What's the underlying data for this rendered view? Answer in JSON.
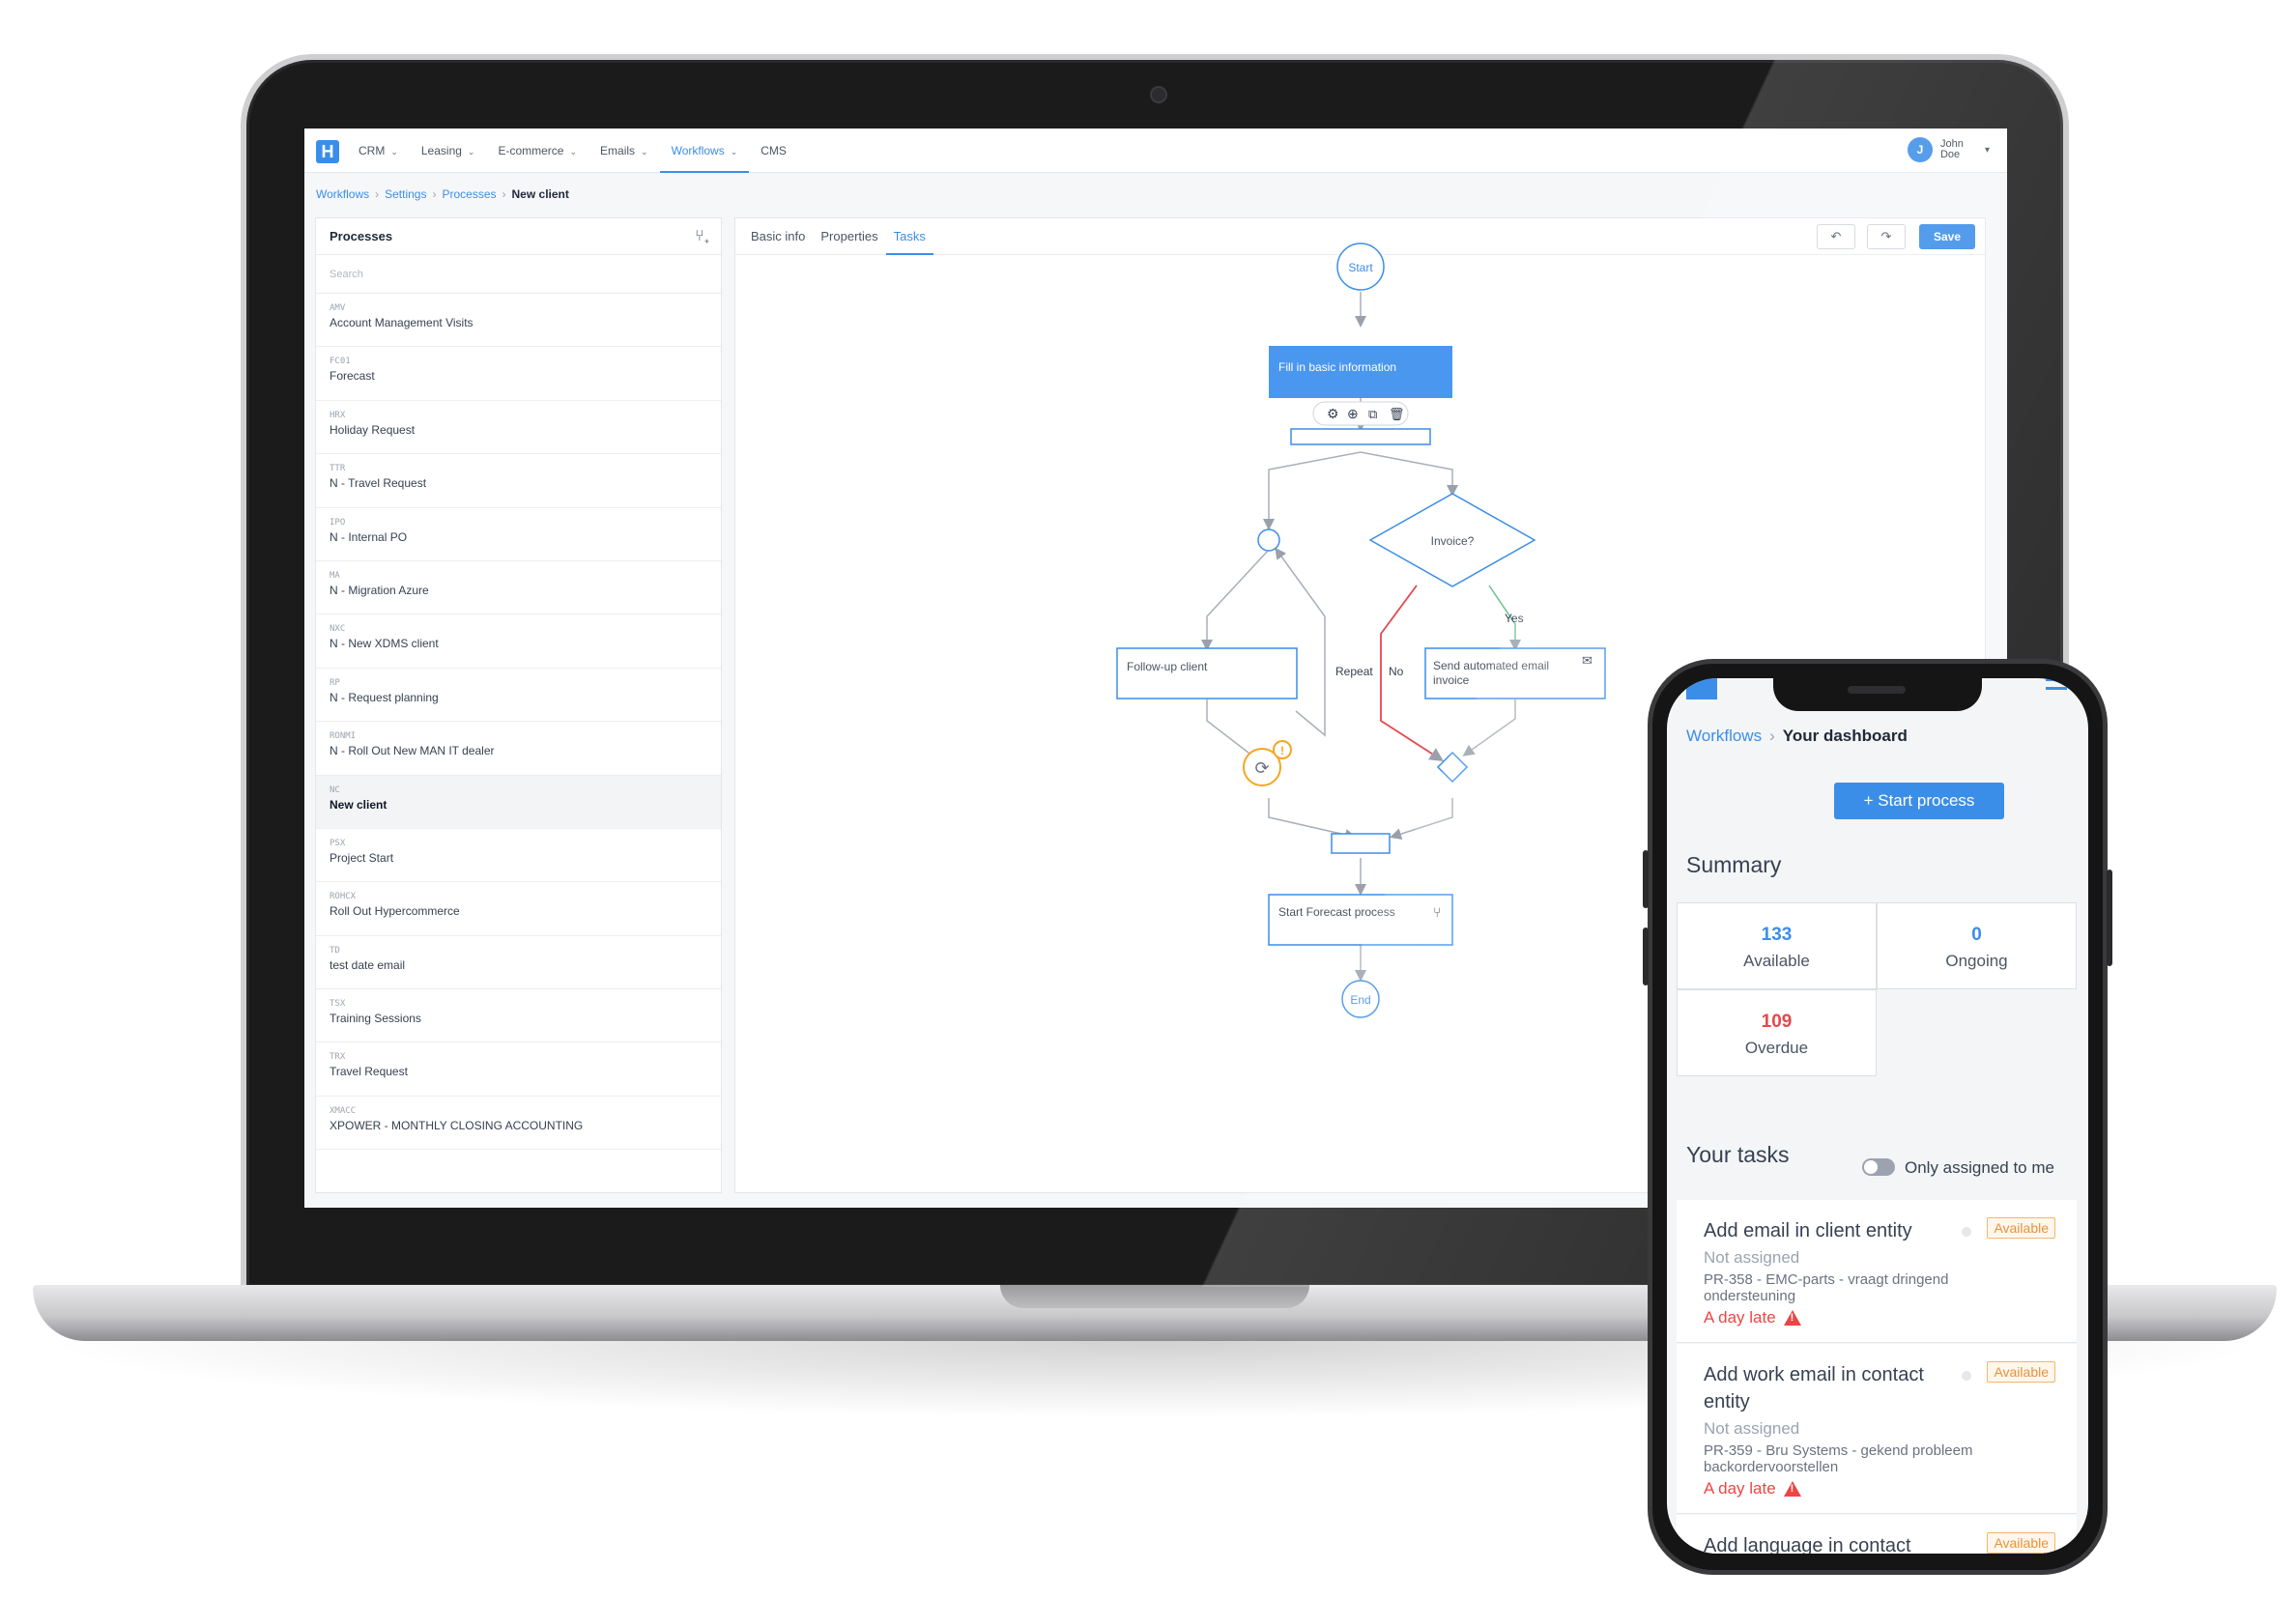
{
  "laptop": {
    "nav": {
      "logo": "H",
      "items": [
        {
          "label": "CRM",
          "active": false
        },
        {
          "label": "Leasing",
          "active": false
        },
        {
          "label": "E-commerce",
          "active": false
        },
        {
          "label": "Emails",
          "active": false
        },
        {
          "label": "Workflows",
          "active": true
        },
        {
          "label": "CMS",
          "active": false
        }
      ],
      "user": {
        "initial": "J",
        "name": "John Doe"
      }
    },
    "breadcrumb": {
      "items": [
        "Workflows",
        "Settings",
        "Processes"
      ],
      "current": "New client"
    },
    "processes": {
      "title": "Processes",
      "search_placeholder": "Search",
      "items": [
        {
          "code": "AMV",
          "name": "Account Management Visits"
        },
        {
          "code": "FC01",
          "name": "Forecast"
        },
        {
          "code": "HRX",
          "name": "Holiday Request"
        },
        {
          "code": "TTR",
          "name": "N - Travel Request"
        },
        {
          "code": "IPO",
          "name": "N - Internal PO"
        },
        {
          "code": "MA",
          "name": "N - Migration Azure"
        },
        {
          "code": "NXC",
          "name": "N - New XDMS client"
        },
        {
          "code": "RP",
          "name": "N - Request planning"
        },
        {
          "code": "RONMI",
          "name": "N - Roll Out New MAN IT dealer"
        },
        {
          "code": "NC",
          "name": "New client",
          "selected": true
        },
        {
          "code": "PSX",
          "name": "Project Start"
        },
        {
          "code": "ROHCX",
          "name": "Roll Out Hypercommerce"
        },
        {
          "code": "TD",
          "name": "test date email"
        },
        {
          "code": "TSX",
          "name": "Training Sessions"
        },
        {
          "code": "TRX",
          "name": "Travel Request"
        },
        {
          "code": "XMACC",
          "name": "XPOWER - MONTHLY CLOSING ACCOUNTING"
        }
      ]
    },
    "editor": {
      "tabs": [
        {
          "label": "Basic info",
          "active": false
        },
        {
          "label": "Properties",
          "active": false
        },
        {
          "label": "Tasks",
          "active": true
        }
      ],
      "undo_icon": "undo-icon",
      "redo_icon": "redo-icon",
      "save_label": "Save",
      "flow": {
        "start": "Start",
        "task_fill": "Fill in basic information",
        "decision": "Invoice?",
        "task_followup": "Follow-up client",
        "task_send_email": "Send automated email invoice",
        "label_repeat": "Repeat",
        "label_no": "No",
        "label_yes": "Yes",
        "task_forecast": "Start Forecast process",
        "end": "End",
        "toolbar_icons": [
          "gear-icon",
          "add-icon",
          "copy-icon",
          "trash-icon"
        ]
      }
    }
  },
  "phone": {
    "breadcrumb": {
      "link": "Workflows",
      "current": "Your dashboard"
    },
    "start_button": "+ Start process",
    "summary": {
      "title": "Summary",
      "cells": [
        {
          "value": "133",
          "label": "Available",
          "color": "#3b8ee8"
        },
        {
          "value": "0",
          "label": "Ongoing",
          "color": "#3b8ee8"
        },
        {
          "value": "109",
          "label": "Overdue",
          "color": "#e5484d"
        }
      ]
    },
    "tasks": {
      "title": "Your tasks",
      "toggle_label": "Only assigned to me",
      "items": [
        {
          "title": "Add email in client entity",
          "badge": "Available",
          "assignee": "Not assigned",
          "ref": "PR-358  - EMC-parts - vraagt dringend ondersteuning",
          "late": "A day late"
        },
        {
          "title": "Add work email in contact entity",
          "badge": "Available",
          "assignee": "Not assigned",
          "ref": "PR-359  - Bru Systems - gekend probleem backordervoorstellen",
          "late": "A day late"
        },
        {
          "title": "Add language in contact",
          "badge": "Available"
        }
      ]
    }
  },
  "colors": {
    "accent": "#3b8ee8",
    "danger": "#e5484d",
    "warning": "#f5a623",
    "success": "#4caf50"
  }
}
